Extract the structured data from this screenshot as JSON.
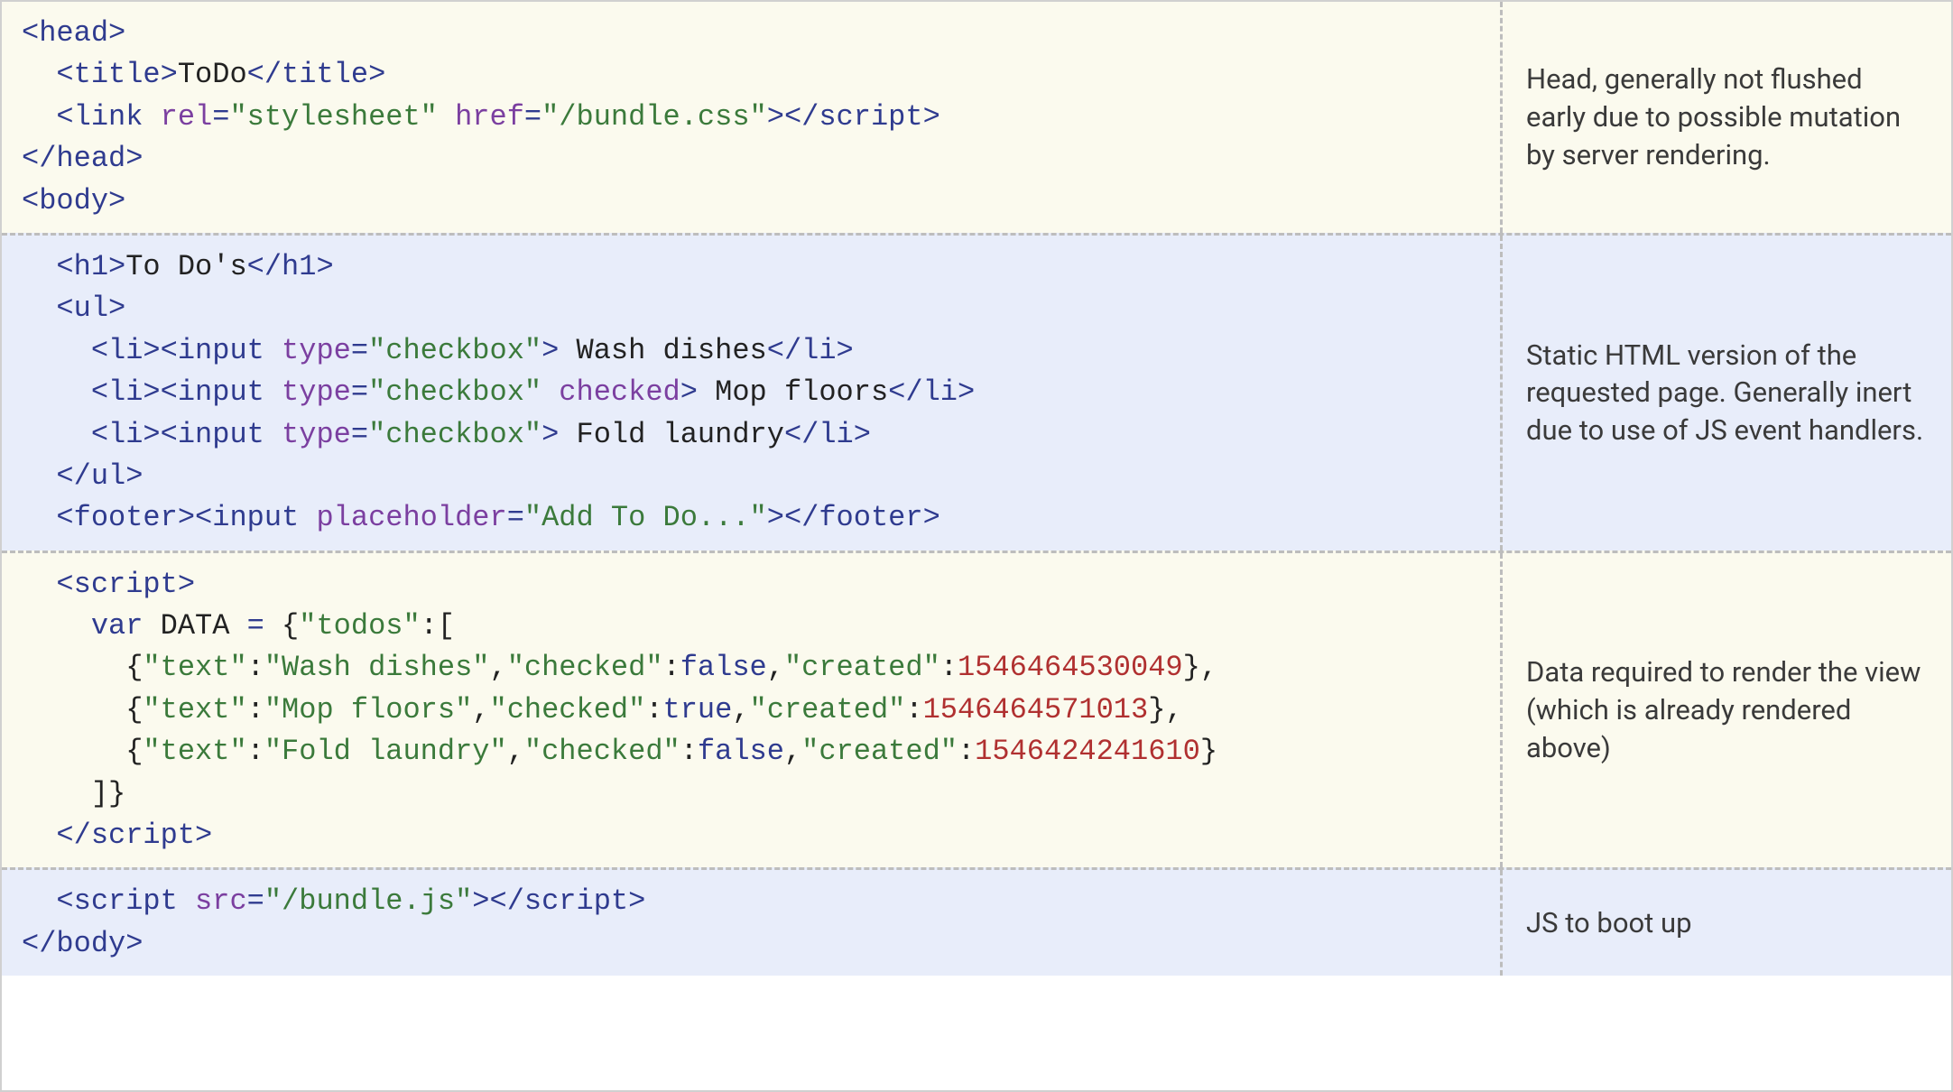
{
  "sections": [
    {
      "id": "head",
      "desc": "Head, generally not flushed early due to possible mutation by server rendering.",
      "code": [
        [
          {
            "t": "tag",
            "v": "<head>"
          }
        ],
        [
          {
            "t": "pad",
            "v": "  "
          },
          {
            "t": "tag",
            "v": "<title>"
          },
          {
            "t": "txt",
            "v": "ToDo"
          },
          {
            "t": "tag",
            "v": "</title>"
          }
        ],
        [
          {
            "t": "pad",
            "v": "  "
          },
          {
            "t": "tag",
            "v": "<link "
          },
          {
            "t": "attr",
            "v": "rel"
          },
          {
            "t": "tag",
            "v": "="
          },
          {
            "t": "str",
            "v": "\"stylesheet\""
          },
          {
            "t": "tag",
            "v": " "
          },
          {
            "t": "attr",
            "v": "href"
          },
          {
            "t": "tag",
            "v": "="
          },
          {
            "t": "str",
            "v": "\"/bundle.css\""
          },
          {
            "t": "tag",
            "v": "></script"
          },
          {
            "t": "tag",
            "v": ">"
          }
        ],
        [
          {
            "t": "tag",
            "v": "</head>"
          }
        ],
        [
          {
            "t": "tag",
            "v": "<body>"
          }
        ]
      ]
    },
    {
      "id": "static-html",
      "desc": "Static HTML version of the requested page. Generally inert due to use of JS event handlers.",
      "code": [
        [
          {
            "t": "pad",
            "v": "  "
          },
          {
            "t": "tag",
            "v": "<h1>"
          },
          {
            "t": "txt",
            "v": "To Do's"
          },
          {
            "t": "tag",
            "v": "</h1>"
          }
        ],
        [
          {
            "t": "pad",
            "v": "  "
          },
          {
            "t": "tag",
            "v": "<ul>"
          }
        ],
        [
          {
            "t": "pad",
            "v": "    "
          },
          {
            "t": "tag",
            "v": "<li><input "
          },
          {
            "t": "attr",
            "v": "type"
          },
          {
            "t": "tag",
            "v": "="
          },
          {
            "t": "str",
            "v": "\"checkbox\""
          },
          {
            "t": "tag",
            "v": ">"
          },
          {
            "t": "txt",
            "v": " Wash dishes"
          },
          {
            "t": "tag",
            "v": "</li>"
          }
        ],
        [
          {
            "t": "pad",
            "v": "    "
          },
          {
            "t": "tag",
            "v": "<li><input "
          },
          {
            "t": "attr",
            "v": "type"
          },
          {
            "t": "tag",
            "v": "="
          },
          {
            "t": "str",
            "v": "\"checkbox\""
          },
          {
            "t": "tag",
            "v": " "
          },
          {
            "t": "attr",
            "v": "checked"
          },
          {
            "t": "tag",
            "v": ">"
          },
          {
            "t": "txt",
            "v": " Mop floors"
          },
          {
            "t": "tag",
            "v": "</li>"
          }
        ],
        [
          {
            "t": "pad",
            "v": "    "
          },
          {
            "t": "tag",
            "v": "<li><input "
          },
          {
            "t": "attr",
            "v": "type"
          },
          {
            "t": "tag",
            "v": "="
          },
          {
            "t": "str",
            "v": "\"checkbox\""
          },
          {
            "t": "tag",
            "v": ">"
          },
          {
            "t": "txt",
            "v": " Fold laundry"
          },
          {
            "t": "tag",
            "v": "</li>"
          }
        ],
        [
          {
            "t": "pad",
            "v": "  "
          },
          {
            "t": "tag",
            "v": "</ul>"
          }
        ],
        [
          {
            "t": "pad",
            "v": "  "
          },
          {
            "t": "tag",
            "v": "<footer><input "
          },
          {
            "t": "attr",
            "v": "placeholder"
          },
          {
            "t": "tag",
            "v": "="
          },
          {
            "t": "str",
            "v": "\"Add To Do...\""
          },
          {
            "t": "tag",
            "v": "></footer>"
          }
        ]
      ]
    },
    {
      "id": "data",
      "desc": "Data required to render the view (which is already rendered above)",
      "code": [
        [
          {
            "t": "pad",
            "v": "  "
          },
          {
            "t": "tag",
            "v": "<script>"
          }
        ],
        [
          {
            "t": "pad",
            "v": "    "
          },
          {
            "t": "kw",
            "v": "var"
          },
          {
            "t": "txt",
            "v": " "
          },
          {
            "t": "ident",
            "v": "DATA"
          },
          {
            "t": "txt",
            "v": " "
          },
          {
            "t": "tag",
            "v": "="
          },
          {
            "t": "txt",
            "v": " {"
          },
          {
            "t": "key",
            "v": "\"todos\""
          },
          {
            "t": "txt",
            "v": ":["
          }
        ],
        [
          {
            "t": "pad",
            "v": "      "
          },
          {
            "t": "txt",
            "v": "{"
          },
          {
            "t": "key",
            "v": "\"text\""
          },
          {
            "t": "txt",
            "v": ":"
          },
          {
            "t": "str",
            "v": "\"Wash dishes\""
          },
          {
            "t": "txt",
            "v": ","
          },
          {
            "t": "key",
            "v": "\"checked\""
          },
          {
            "t": "txt",
            "v": ":"
          },
          {
            "t": "bool",
            "v": "false"
          },
          {
            "t": "txt",
            "v": ","
          },
          {
            "t": "key",
            "v": "\"created\""
          },
          {
            "t": "txt",
            "v": ":"
          },
          {
            "t": "num",
            "v": "1546464530049"
          },
          {
            "t": "txt",
            "v": "},"
          }
        ],
        [
          {
            "t": "pad",
            "v": "      "
          },
          {
            "t": "txt",
            "v": "{"
          },
          {
            "t": "key",
            "v": "\"text\""
          },
          {
            "t": "txt",
            "v": ":"
          },
          {
            "t": "str",
            "v": "\"Mop floors\""
          },
          {
            "t": "txt",
            "v": ","
          },
          {
            "t": "key",
            "v": "\"checked\""
          },
          {
            "t": "txt",
            "v": ":"
          },
          {
            "t": "bool",
            "v": "true"
          },
          {
            "t": "txt",
            "v": ","
          },
          {
            "t": "key",
            "v": "\"created\""
          },
          {
            "t": "txt",
            "v": ":"
          },
          {
            "t": "num",
            "v": "1546464571013"
          },
          {
            "t": "txt",
            "v": "},"
          }
        ],
        [
          {
            "t": "pad",
            "v": "      "
          },
          {
            "t": "txt",
            "v": "{"
          },
          {
            "t": "key",
            "v": "\"text\""
          },
          {
            "t": "txt",
            "v": ":"
          },
          {
            "t": "str",
            "v": "\"Fold laundry\""
          },
          {
            "t": "txt",
            "v": ","
          },
          {
            "t": "key",
            "v": "\"checked\""
          },
          {
            "t": "txt",
            "v": ":"
          },
          {
            "t": "bool",
            "v": "false"
          },
          {
            "t": "txt",
            "v": ","
          },
          {
            "t": "key",
            "v": "\"created\""
          },
          {
            "t": "txt",
            "v": ":"
          },
          {
            "t": "num",
            "v": "1546424241610"
          },
          {
            "t": "txt",
            "v": "}"
          }
        ],
        [
          {
            "t": "pad",
            "v": "    "
          },
          {
            "t": "txt",
            "v": "]}"
          }
        ],
        [
          {
            "t": "pad",
            "v": "  "
          },
          {
            "t": "tag",
            "v": "</script"
          },
          {
            "t": "tag",
            "v": ">"
          }
        ]
      ]
    },
    {
      "id": "boot",
      "desc": "JS to boot up",
      "code": [
        [
          {
            "t": "pad",
            "v": "  "
          },
          {
            "t": "tag",
            "v": "<script "
          },
          {
            "t": "attr",
            "v": "src"
          },
          {
            "t": "tag",
            "v": "="
          },
          {
            "t": "str",
            "v": "\"/bundle.js\""
          },
          {
            "t": "tag",
            "v": "></script"
          },
          {
            "t": "tag",
            "v": ">"
          }
        ],
        [
          {
            "t": "tag",
            "v": "</body>"
          }
        ]
      ]
    }
  ]
}
